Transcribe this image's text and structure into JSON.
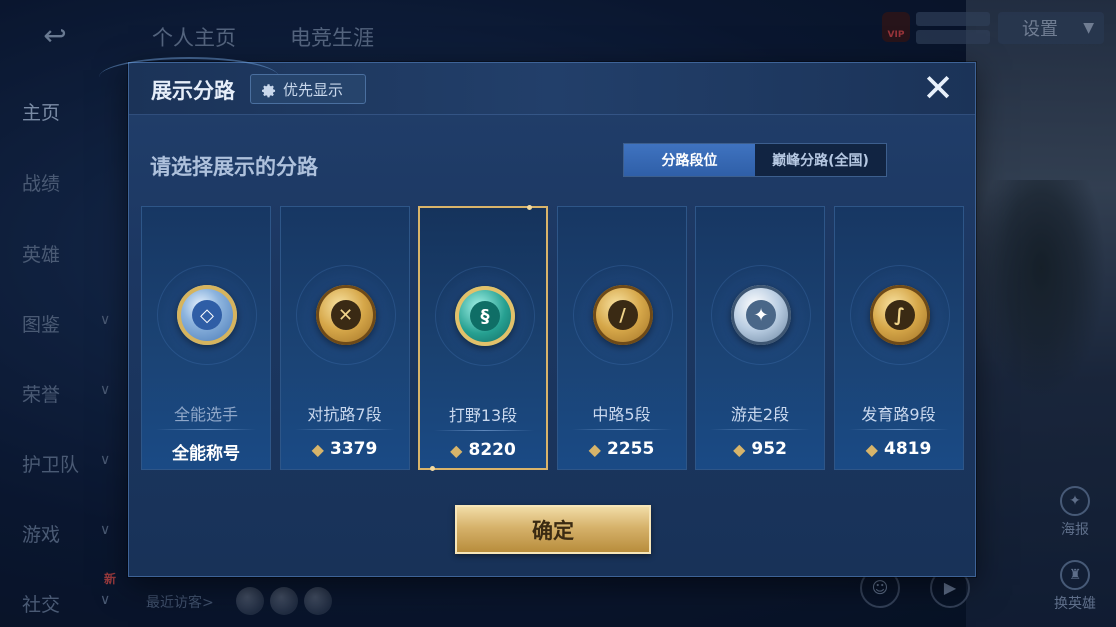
{
  "topbar": {
    "back_glyph": "↩",
    "tabs": [
      "个人主页",
      "电竞生涯"
    ],
    "vip_label": "VIP",
    "settings_label": "设置",
    "settings_caret": "▼"
  },
  "sidebar": {
    "items": [
      {
        "label": "主页",
        "chevron": ""
      },
      {
        "label": "战绩",
        "chevron": ""
      },
      {
        "label": "英雄",
        "chevron": ""
      },
      {
        "label": "图鉴",
        "chevron": "∨"
      },
      {
        "label": "荣誉",
        "chevron": "∨"
      },
      {
        "label": "护卫队",
        "chevron": "∨"
      },
      {
        "label": "游戏",
        "chevron": "∨"
      },
      {
        "label": "社交",
        "chevron": "∨"
      }
    ],
    "new_badge": "新"
  },
  "bottom": {
    "visitors_label": "最近访客>",
    "poster_label": "海报",
    "switch_hero_label": "换英雄"
  },
  "modal": {
    "title": "展示分路",
    "priority_label": "优先显示",
    "close_glyph": "✕",
    "subtitle": "请选择展示的分路",
    "toggle": [
      "分路段位",
      "巅峰分路(全国)"
    ],
    "cards": [
      {
        "label": "全能选手",
        "value": "全能称号",
        "icon": "all-round-emblem",
        "style": "blue",
        "glyph": "◇",
        "show_points": false
      },
      {
        "label": "对抗路7段",
        "value": "3379",
        "icon": "clash-lane-emblem",
        "style": "gold",
        "glyph": "✕",
        "show_points": true
      },
      {
        "label": "打野13段",
        "value": "8220",
        "icon": "jungle-emblem",
        "style": "teal",
        "glyph": "§",
        "show_points": true
      },
      {
        "label": "中路5段",
        "value": "2255",
        "icon": "mid-lane-emblem",
        "style": "gold",
        "glyph": "/",
        "show_points": true
      },
      {
        "label": "游走2段",
        "value": "952",
        "icon": "roam-emblem",
        "style": "silver",
        "glyph": "✦",
        "show_points": true
      },
      {
        "label": "发育路9段",
        "value": "4819",
        "icon": "farm-lane-emblem",
        "style": "gold",
        "glyph": "∫",
        "show_points": true
      }
    ],
    "selected_index": 2,
    "confirm_label": "确定"
  },
  "colors": {
    "accent_gold": "#d9b46a",
    "toggle_active": "#3f73c0",
    "modal_bg": "#1c3762"
  }
}
